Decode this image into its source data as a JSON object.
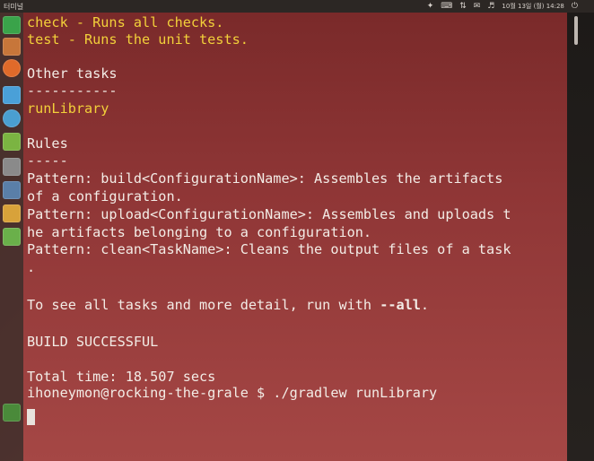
{
  "top_panel": {
    "title": "터미널",
    "date": "10월 13일 (월) 14:28",
    "icons": [
      "dropbox-icon",
      "keyboard-icon",
      "network-icon",
      "mail-icon",
      "volume-icon",
      "power-icon"
    ]
  },
  "launcher": {
    "items": [
      {
        "name": "launcher-item-dash",
        "color": "#3aa34a"
      },
      {
        "name": "launcher-item-files",
        "color": "#c7763a"
      },
      {
        "name": "launcher-item-firefox",
        "color": "#e06a2a"
      },
      {
        "name": "launcher-item-twitter",
        "color": "#4aa0d8"
      },
      {
        "name": "launcher-item-software",
        "color": "#4a9fd0"
      },
      {
        "name": "launcher-item-notes",
        "color": "#7bb442"
      },
      {
        "name": "launcher-item-mail",
        "color": "#8a8a8a"
      },
      {
        "name": "launcher-item-settings",
        "color": "#5a7fa8"
      },
      {
        "name": "launcher-item-document",
        "color": "#d8a23a"
      },
      {
        "name": "launcher-item-editor",
        "color": "#6ab04a"
      },
      {
        "name": "launcher-item-terminal",
        "color": "#4a8a3a"
      }
    ]
  },
  "terminal": {
    "lines": {
      "l1": "check - Runs all checks.",
      "l2": "test - Runs the unit tests.",
      "l3": "Other tasks",
      "l4": "-----------",
      "l5": "runLibrary",
      "l6": "Rules",
      "l7": "-----",
      "l8": "Pattern: build<ConfigurationName>: Assembles the artifacts",
      "l9": "of a configuration.",
      "l10": "Pattern: upload<ConfigurationName>: Assembles and uploads t",
      "l11": "he artifacts belonging to a configuration.",
      "l12": "Pattern: clean<TaskName>: Cleans the output files of a task",
      "l13": ".",
      "l14_prefix": "To see all tasks and more detail, run with ",
      "l14_flag": "--all",
      "l14_suffix": ".",
      "l15": "BUILD SUCCESSFUL",
      "l16": "Total time: 18.507 secs",
      "l17": "ihoneymon@rocking-the-grale $ ./gradlew runLibrary"
    },
    "text_color": "#f3ece6",
    "highlight_color": "#f2d03a"
  }
}
